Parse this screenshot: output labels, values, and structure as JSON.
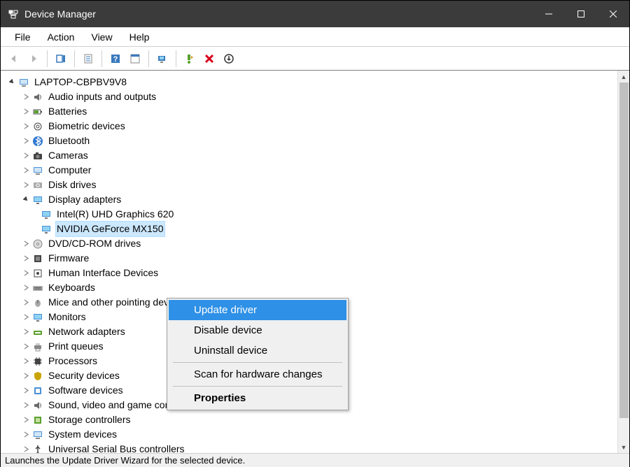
{
  "window_title": "Device Manager",
  "menu": {
    "file": "File",
    "action": "Action",
    "view": "View",
    "help": "Help"
  },
  "tree": {
    "root": "LAPTOP-CBPBV9V8",
    "categories": [
      "Audio inputs and outputs",
      "Batteries",
      "Biometric devices",
      "Bluetooth",
      "Cameras",
      "Computer",
      "Disk drives",
      "Display adapters",
      "DVD/CD-ROM drives",
      "Firmware",
      "Human Interface Devices",
      "Keyboards",
      "Mice and other pointing devices",
      "Monitors",
      "Network adapters",
      "Print queues",
      "Processors",
      "Security devices",
      "Software devices",
      "Sound, video and game controllers",
      "Storage controllers",
      "System devices",
      "Universal Serial Bus controllers"
    ],
    "display_adapters": [
      "Intel(R) UHD Graphics 620",
      "NVIDIA GeForce MX150"
    ]
  },
  "context_menu": {
    "update_driver": "Update driver",
    "disable_device": "Disable device",
    "uninstall_device": "Uninstall device",
    "scan": "Scan for hardware changes",
    "properties": "Properties"
  },
  "status_text": "Launches the Update Driver Wizard for the selected device."
}
